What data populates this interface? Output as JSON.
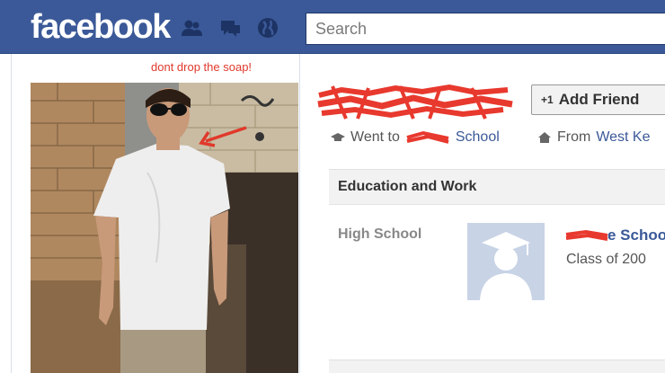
{
  "header": {
    "logo_text": "facebook",
    "search_placeholder": "Search",
    "jewels": [
      "friend-requests-icon",
      "messages-icon",
      "notifications-icon"
    ]
  },
  "photo": {
    "caption": "dont drop the soap!"
  },
  "profile": {
    "add_friend_label": "Add Friend",
    "went_to_prefix": "Went to",
    "went_to_school_visible": "School",
    "from_prefix": "From",
    "from_location_visible": "West Ke"
  },
  "education": {
    "section_title": "Education and Work",
    "high_school_label": "High School",
    "school_name_visible": "e Schoo",
    "class_of": "Class of 200"
  },
  "colors": {
    "brand_blue": "#3b5998",
    "redaction_red": "#e8392e",
    "caption_red": "#e0392b"
  }
}
